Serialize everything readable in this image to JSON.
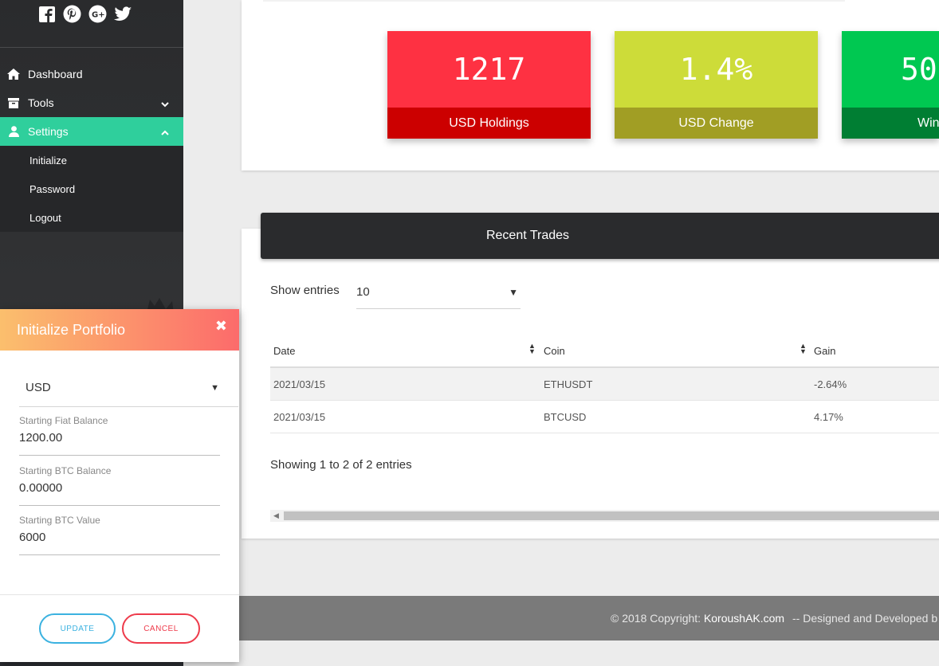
{
  "sidebar": {
    "social": [
      "facebook-icon",
      "pinterest-icon",
      "google-plus-icon",
      "twitter-icon"
    ],
    "items": [
      {
        "label": "Dashboard",
        "icon": "home-icon"
      },
      {
        "label": "Tools",
        "icon": "archive-icon"
      },
      {
        "label": "Settings",
        "icon": "user-icon"
      }
    ],
    "subitems": [
      "Initialize",
      "Password",
      "Logout"
    ],
    "active_color": "#2fcf9c"
  },
  "stats": [
    {
      "value": "1217",
      "label": "USD Holdings",
      "color": "#fe3142",
      "label_color": "#cc0000"
    },
    {
      "value": "1.4%",
      "label": "USD Change",
      "color": "#cddc39",
      "label_color": "#a19e24"
    },
    {
      "value": "50",
      "label": "Win",
      "color": "#00c851",
      "label_color": "#007e33"
    }
  ],
  "trades": {
    "title": "Recent Trades",
    "show_entries_label": "Show entries",
    "entries_value": "10",
    "columns": [
      "Date",
      "Coin",
      "Gain"
    ],
    "rows": [
      {
        "date": "2021/03/15",
        "coin": "ETHUSDT",
        "gain": "-2.64%"
      },
      {
        "date": "2021/03/15",
        "coin": "BTCUSD",
        "gain": "4.17%"
      }
    ],
    "showing": "Showing 1 to 2 of 2 entries"
  },
  "footer": {
    "copyright": "© 2018 Copyright:",
    "link": "KoroushAK.com",
    "tail": "--  Designed and Developed b"
  },
  "modal": {
    "title": "Initialize Portfolio",
    "currency": "USD",
    "fields": [
      {
        "label": "Starting Fiat Balance",
        "value": "1200.00"
      },
      {
        "label": "Starting BTC Balance",
        "value": "0.00000"
      },
      {
        "label": "Starting BTC Value",
        "value": "6000"
      }
    ],
    "update_label": "UPDATE",
    "cancel_label": "CANCEL"
  }
}
